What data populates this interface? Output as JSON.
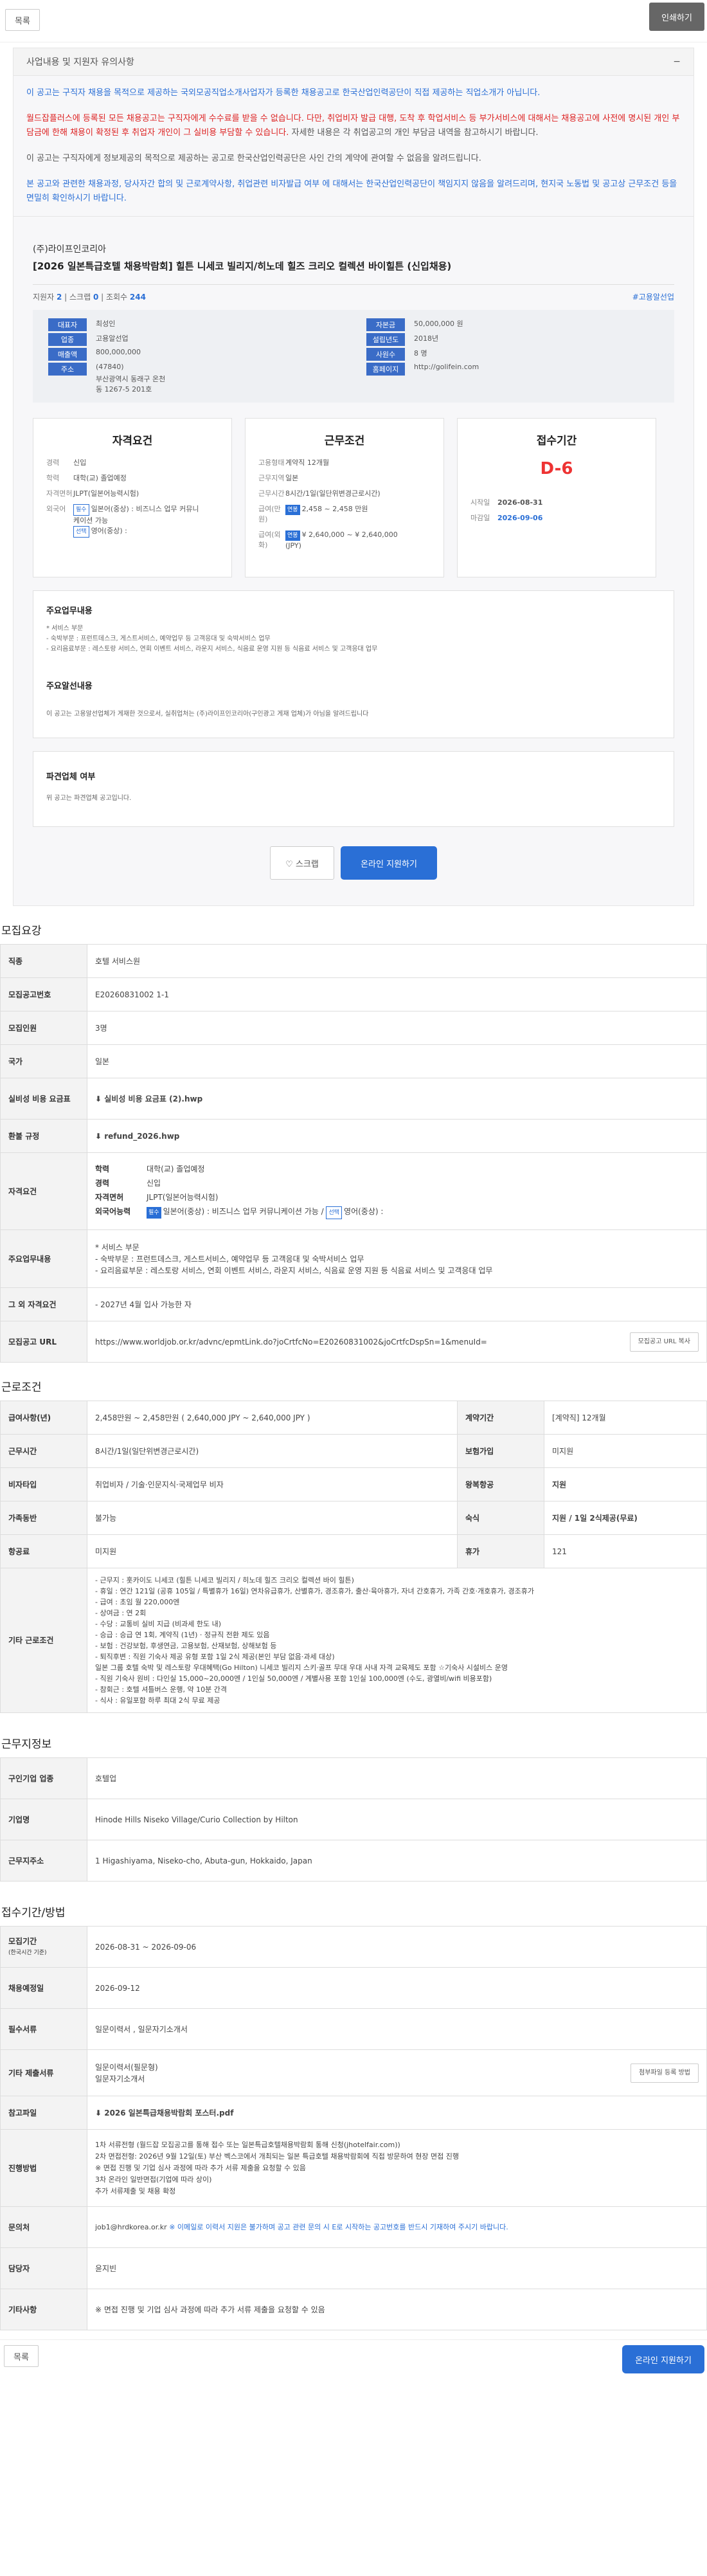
{
  "top": {
    "back": "목록",
    "print": "인쇄하기"
  },
  "notice": {
    "title": "사업내용 및 지원자 유의사항",
    "toggle": "−",
    "p1": "이 공고는 구직자 채용을 목적으로 제공하는 국외모공직업소개사업자가 등록한 채용공고로 한국산업인력공단이 직접 제공하는 직업소개가 아닙니다.",
    "p2": "월드잡플러스에 등록된 모든 채용공고는 구직자에게 수수료를 받을 수 없습니다. 다만, 취업비자 발급 대행, 도착 후 학업서비스 등 부가서비스에 대해서는 채용공고에 사전에 명시된 개인 부담금에 한해 채용이 확정된 후 취업자 개인이 그 실비용 부담할 수 있습니다.",
    "p2b": " 자세한 내용은 각 취업공고의 개인 부담금 내역을 참고하시기 바랍니다.",
    "p3": "이 공고는 구직자에게 정보제공의 목적으로 제공하는 공고로 한국산업인력공단은 사인 간의 계약에 관여할 수 없음을 알려드립니다.",
    "p4": "본 공고와 관련한 채용과정, 당사자간 합의 및 근로계약사항, 취업관련 비자발급 여부 에 대해서는 한국산업인력공단이 책임지지 않음을 알려드리며, 현지국 노동법 및 공고상 근무조건 등을 면밀히 확인하시기 바랍니다."
  },
  "job": {
    "company": "(주)라이프인코리아",
    "title": "[2026 일본특급호텔 채용박람회] 힐튼 니세코 빌리지/히노데 힐즈 크리오 컬렉션 바이힐튼 (신입채용)",
    "stat_applicants_label": "지원자",
    "stat_applicants": "2",
    "stat_scrap_label": "스크랩",
    "stat_scrap": "0",
    "stat_views_label": "조회수",
    "stat_views": "244",
    "tag": "#고용알선업",
    "info_left": [
      {
        "k": "대표자",
        "v": "최성인"
      },
      {
        "k": "업종",
        "v": "고용알선업"
      },
      {
        "k": "매출액",
        "v": "800,000,000"
      },
      {
        "k": "주소",
        "v": "(47840)"
      }
    ],
    "address": "부산광역시 동래구 온천동 1267-5 201호",
    "info_right": [
      {
        "k": "자본금",
        "v": "50,000,000 원"
      },
      {
        "k": "설립년도",
        "v": "2018년"
      },
      {
        "k": "사원수",
        "v": "8 명"
      },
      {
        "k": "홈페이지",
        "v": "http://golifein.com"
      }
    ]
  },
  "qual": {
    "title": "자격요건",
    "rows": [
      {
        "k": "경력",
        "v": "신입"
      },
      {
        "k": "학력",
        "v": "대학(교) 졸업예정"
      },
      {
        "k": "자격면허",
        "v": "JLPT(일본어능력시험)"
      }
    ],
    "lang_k": "외국어",
    "lang1_tag": "필수",
    "lang1": "일본어(중상) : 비즈니스 업무 커뮤니케이션 가능",
    "lang2_tag": "선택",
    "lang2": "영어(중상) :"
  },
  "cond": {
    "title": "근무조건",
    "rows": [
      {
        "k": "고용형태",
        "v": "계약직 12개월"
      },
      {
        "k": "근무지역",
        "v": "일본"
      },
      {
        "k": "근무시간",
        "v": "8시간/1일(일단위변경근로시간)"
      }
    ],
    "pay_k": "급여(만원)",
    "pay_tag": "연봉",
    "pay": "2,458 ~ 2,458 만원",
    "pay2_k": "급여(외화)",
    "pay2_tag": "연봉",
    "pay2": "¥ 2,640,000 ~ ¥ 2,640,000 (JPY)"
  },
  "period": {
    "title": "접수기간",
    "dday": "D-6",
    "start_k": "시작일",
    "start": "2026-08-31",
    "end_k": "마감일",
    "end": "2026-09-06"
  },
  "duty": {
    "title": "주요업무내용",
    "l1": "* 서비스 부문",
    "l2": "- 숙박부문 : 프런트데스크, 게스트서비스, 예약업무 등 고객응대 및 숙박서비스 업무",
    "l3": "- 요리음료부문 : 레스토랑 서비스, 연회 이벤트 서비스, 라운지 서비스, 식음료 운영 지원 등 식음료 서비스 및 고객응대 업무"
  },
  "org": {
    "title": "주요알선내용",
    "text": "이 공고는 고용알선업체가 게재한 것으로서, 실취업처는 (주)라이프인코리아(구인광고 게재 업체)가 아님을 알려드립니다"
  },
  "dispatch": {
    "title": "파견업체 여부",
    "text": "위 공고는 파견업체 공고입니다."
  },
  "actions": {
    "scrap": "♡ 스크랩",
    "apply": "온라인 지원하기"
  },
  "recruit": {
    "title": "모집요강",
    "job_k": "직종",
    "job": "호텔 서비스원",
    "no_k": "모집공고번호",
    "no": "E20260831002 1-1",
    "cnt_k": "모집인원",
    "cnt": "3명",
    "country_k": "국가",
    "country": "일본",
    "cost_k": "실비성 비용 요금표",
    "cost": "실비성 비용 요금표 (2).hwp",
    "refund_k": "환불 규정",
    "refund": "refund_2026.hwp",
    "qual_k": "자격요건",
    "q_edu_k": "학력",
    "q_edu": "대학(교) 졸업예정",
    "q_car_k": "경력",
    "q_car": "신입",
    "q_lic_k": "자격면허",
    "q_lic": "JLPT(일본어능력시험)",
    "q_lang_k": "외국어능력",
    "q_tag1": "필수",
    "q_lang1": "일본어(중상) : 비즈니스 업무 커뮤니케이션 가능",
    "q_tag2": "선택",
    "q_lang2": "영어(중상) :",
    "duty_k": "주요업무내용",
    "duty1": "* 서비스 부문",
    "duty2": "- 숙박부문 : 프런트데스크, 게스트서비스, 예약업무 등 고객응대 및 숙박서비스 업무",
    "duty3": "- 요리음료부문 : 레스토랑 서비스, 연회 이벤트 서비스, 라운지 서비스, 식음료 운영 지원 등 식음료 서비스 및 고객응대 업무",
    "etc_k": "그 외 자격요건",
    "etc": "- 2027년 4월 입사 가능한 자",
    "url_k": "모집공고 URL",
    "url": "https://www.worldjob.or.kr/advnc/epmtLink.do?joCrtfcNo=E20260831002&joCrtfcDspSn=1&menuId=",
    "url_btn": "모집공고 URL 복사"
  },
  "work": {
    "title": "근로조건",
    "sal_k": "급여사항(년)",
    "sal": "2,458만원 ~ 2,458만원 ( 2,640,000 JPY ~ 2,640,000 JPY )",
    "term_k": "계약기간",
    "term": "[계약직] 12개월",
    "hours_k": "근무시간",
    "hours": "8시간/1일(일단위변경근로시간)",
    "ins_k": "보험가입",
    "ins": "미지원",
    "visa_k": "비자타입",
    "visa": "취업비자 / 기술·인문지식·국제업무 비자",
    "air_k": "왕복항공",
    "air": "지원",
    "family_k": "가족동반",
    "family": "불가능",
    "house_k": "숙식",
    "house": "지원 / 1일 2식제공(무료)",
    "return_k": "항공료",
    "return": "미지원",
    "vac_k": "휴가",
    "vac": "121",
    "other_k": "기타 근로조건",
    "other": [
      "- 근무지 : 홋카이도 니세코 (힐튼 니세코 빌리지 / 히노데 힐즈 크리오 컬렉션 바이 힐튼)",
      "- 휴일 : 연간 121일 (공휴 105일 / 특별휴가 16일) 연차유급휴가, 산별휴가, 경조휴가, 출산·육아휴가, 자녀 간호휴가, 가족 간호·개호휴가, 경조휴가",
      "- 급여 : 초임 월 220,000엔",
      "- 상여금 : 연 2회",
      "- 수당 : 교통비 실비 지급 (비과세 한도 내)",
      "- 승급 : 승급 연 1회, 계약직 (1년) · 정규직 전환 제도 있음",
      "- 보험 : 건강보험, 후생연금, 고용보험, 산재보험, 상해보험 등",
      "- 퇴직후변 : 직원 기숙사 제공 유형 포함 1일 2식 제공(본인 부담 없음·과세 대상)",
      "일본 그룹 호텔 숙박 및 레스토랑 우대혜택(Go Hilton) 니세코 빌리지 스키·골프 무대 우대 사내 자격 교육제도 포함 ☆기숙사 시설비스 운영",
      "- 직원 기숙사 원비 : 다인실 15,000~20,000엔 / 1인실 50,000엔 / 계별사용 포함 1인실 100,000엔 (수도, 광열비/wifi 비용포함)",
      "- 참회근 : 호텔 셔틀버스 운행, 약 10분 간격",
      "- 식사 : 유일포함 하루 최대 2식 무료 제공"
    ]
  },
  "place": {
    "title": "근무지정보",
    "ind_k": "구인기업 업종",
    "ind": "호텔업",
    "name_k": "기업명",
    "name": "Hinode Hills Niseko Village/Curio Collection by Hilton",
    "addr_k": "근무지주소",
    "addr": "1 Higashiyama, Niseko-cho, Abuta-gun, Hokkaido, Japan"
  },
  "apply": {
    "title": "접수기간/방법",
    "period_k": "모집기간",
    "period_sub": "(한국시간 기준)",
    "period": "2026-08-31 ~ 2026-09-06",
    "plan_k": "채용예정일",
    "plan": "2026-09-12",
    "docs_k": "필수서류",
    "docs": "일문이력서 , 일문자기소개서",
    "extra_k": "기타 제출서류",
    "extra1": "일문이력서(필문형)",
    "extra2": "일문자기소개서",
    "extra_btn": "첨부파일 등록 방법",
    "file_k": "참고파일",
    "file": "2026 일본특급채용박람회 포스터.pdf",
    "proc_k": "진행방법",
    "proc": [
      "1차 서류전형 (월드잡 모집공고를 통해 접수 또는 일본특급호텔채용박람회 통해 신청(jhotelfair.com))",
      "2차 면접전형: 2026년 9월 12일(토) 부산 벡스코에서 개최되는 일본 특급호텔 채용박람회에 직접 방문하여 현장 면접 진행",
      "※ 면접 진행 및 기업 심사 과정에 따라 추가 서류 제출을 요청할 수 있음",
      "3차 온라인 일반면접(기업에 따라 상이)",
      "추가 서류제출 및 채용 확정"
    ],
    "mail_k": "문의처",
    "mail": "job1@hrdkorea.or.kr",
    "mail_note": "※ 이메일로 이력서 지원은 불가하며 공고 관련 문의 시 E로 시작하는 공고번호를 반드시 기재하여 주시기 바랍니다.",
    "manager_k": "담당자",
    "manager": "윤지빈",
    "etc_k": "기타사항",
    "etc": "※ 면접 진행 및 기업 심사 과정에 따라 추가 서류 제출을 요청할 수 있음"
  },
  "bottom": {
    "back": "목록",
    "apply": "온라인 지원하기"
  }
}
